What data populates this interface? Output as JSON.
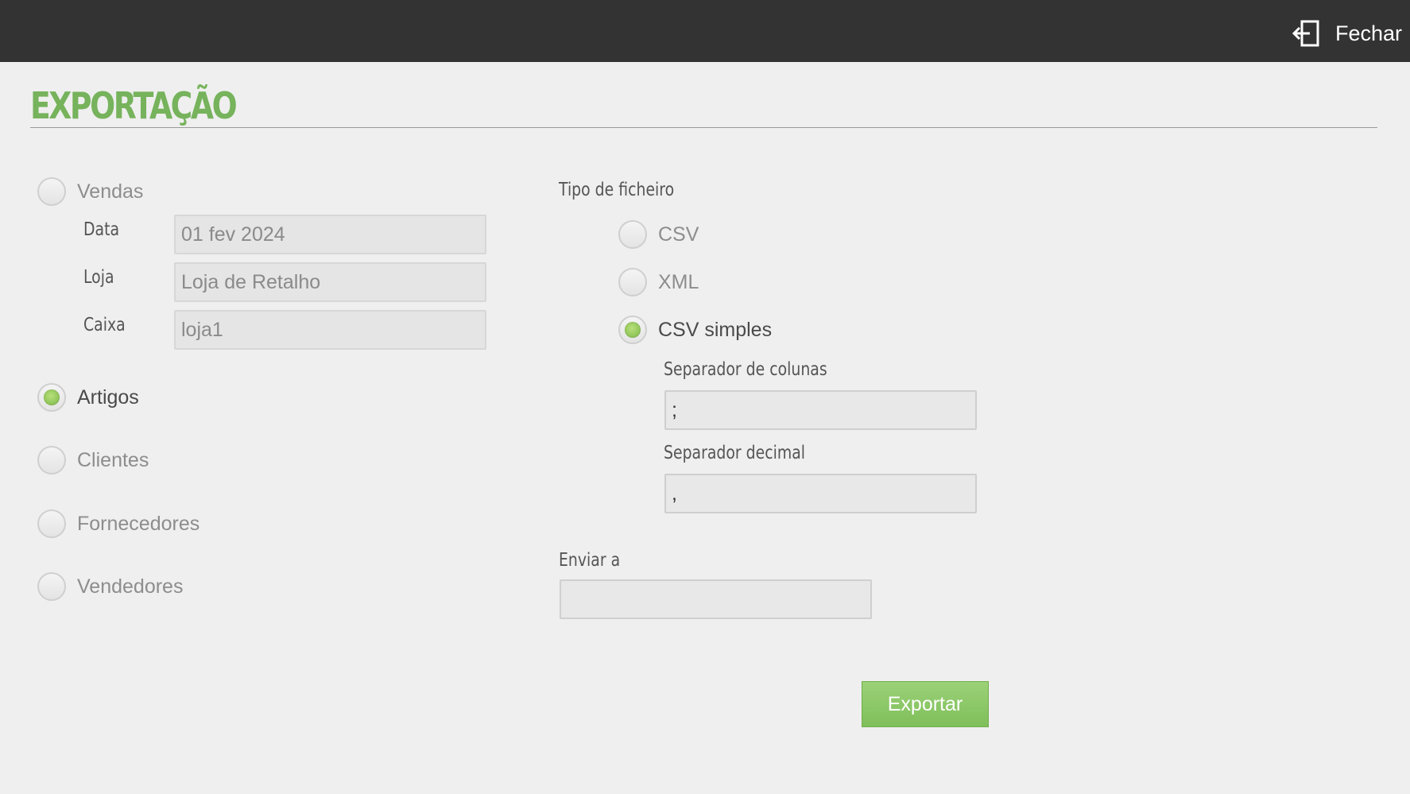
{
  "header": {
    "close_label": "Fechar",
    "close_icon": "exit-icon"
  },
  "page": {
    "title": "EXPORTAÇÃO"
  },
  "export_types": [
    {
      "label": "Vendas",
      "selected": false
    },
    {
      "label": "Artigos",
      "selected": true
    },
    {
      "label": "Clientes",
      "selected": false
    },
    {
      "label": "Fornecedores",
      "selected": false
    },
    {
      "label": "Vendedores",
      "selected": false
    }
  ],
  "sales_fields": {
    "date_label": "Data",
    "date_value": "01 fev 2024",
    "store_label": "Loja",
    "store_value": "Loja de Retalho",
    "register_label": "Caixa",
    "register_value": "loja1"
  },
  "file_type": {
    "label": "Tipo de ficheiro",
    "options": [
      {
        "label": "CSV",
        "selected": false
      },
      {
        "label": "XML",
        "selected": false
      },
      {
        "label": "CSV simples",
        "selected": true
      }
    ],
    "column_separator_label": "Separador de colunas",
    "column_separator_value": ";",
    "decimal_separator_label": "Separador decimal",
    "decimal_separator_value": ","
  },
  "send_to": {
    "label": "Enviar a",
    "value": ""
  },
  "actions": {
    "export_label": "Exportar"
  },
  "colors": {
    "accent": "#76b35c",
    "topbar": "#333333",
    "background": "#efefef"
  }
}
